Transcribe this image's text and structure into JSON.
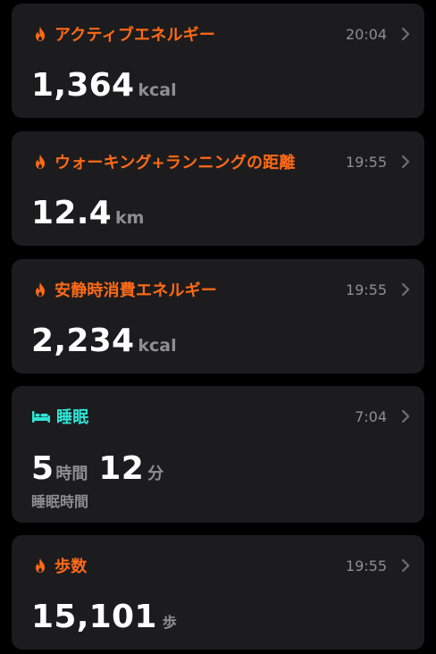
{
  "colors": {
    "activity_orange": "#ff6a16",
    "sleep_teal": "#2ee5d6",
    "card_bg": "#1c1c1e",
    "secondary_text": "#8e8e93"
  },
  "cards": [
    {
      "icon": "flame-icon",
      "title": "アクティブエネルギー",
      "time": "20:04",
      "value": "1,364",
      "unit": "kcal"
    },
    {
      "icon": "flame-icon",
      "title": "ウォーキング+ランニングの距離",
      "time": "19:55",
      "value": "12.4",
      "unit": "km"
    },
    {
      "icon": "flame-icon",
      "title": "安静時消費エネルギー",
      "time": "19:55",
      "value": "2,234",
      "unit": "kcal"
    },
    {
      "icon": "bed-icon",
      "title": "睡眠",
      "time": "7:04",
      "hours": "5",
      "hours_unit": "時間",
      "minutes": "12",
      "minutes_unit": "分",
      "caption": "睡眠時間"
    },
    {
      "icon": "flame-icon",
      "title": "歩数",
      "time": "19:55",
      "value": "15,101",
      "unit": "歩"
    }
  ]
}
